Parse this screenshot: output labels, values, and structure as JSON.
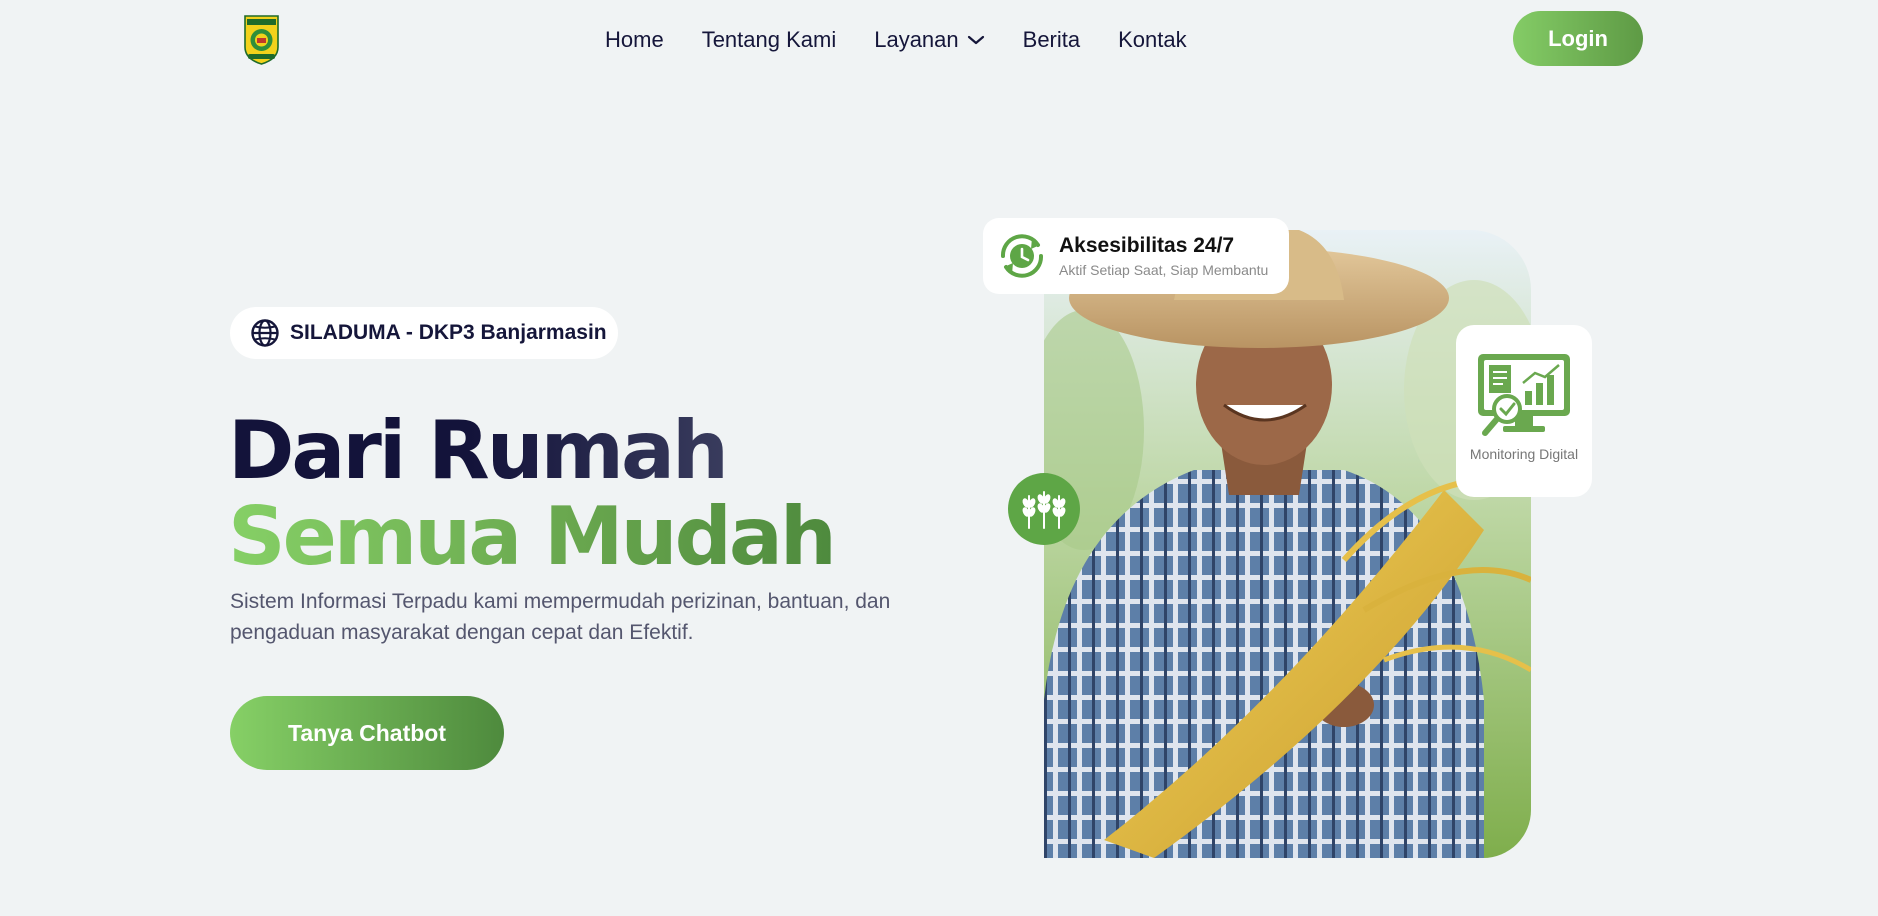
{
  "nav": {
    "logo_alt": "Logo Kota Banjarmasin",
    "links": [
      {
        "label": "Home"
      },
      {
        "label": "Tentang Kami"
      },
      {
        "label": "Layanan"
      },
      {
        "label": "Berita"
      },
      {
        "label": "Kontak"
      }
    ],
    "login_label": "Login"
  },
  "hero": {
    "badge": "SILADUMA - DKP3 Banjarmasin",
    "title_line1": "Dari Rumah",
    "title_line2": "Semua Mudah",
    "description": "Sistem Informasi Terpadu kami mempermudah perizinan, bantuan, dan pengaduan masyarakat dengan cepat dan Efektif.",
    "cta_label": "Tanya Chatbot"
  },
  "cards": {
    "access_title": "Aksesibilitas 24/7",
    "access_subtitle": "Aktif Setiap Saat, Siap Membantu",
    "monitoring_label": "Monitoring Digital"
  },
  "colors": {
    "brand_green": "#6aa84f",
    "brand_green_light": "#86d066",
    "navy": "#13133a",
    "background": "#f0f3f4"
  },
  "icons": {
    "badge": "globe-icon",
    "layanan_dropdown": "chevron-down-icon",
    "access_card": "clock-refresh-icon",
    "monitoring_card": "monitor-chart-icon",
    "floating_circle": "wheat-icon"
  }
}
